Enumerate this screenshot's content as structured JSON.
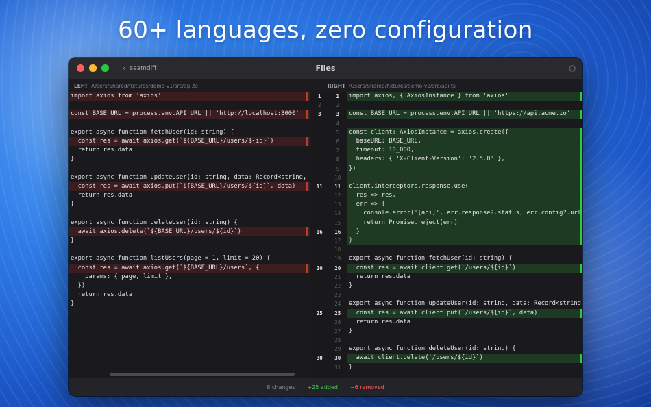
{
  "headline": "60+ languages, zero configuration",
  "window": {
    "app_name": "seamdiff",
    "title": "Files"
  },
  "paths": {
    "left_tag": "LEFT",
    "left_path": "/Users/Shared/fixtures/demo-v1/src/api.ts",
    "right_tag": "RIGHT",
    "right_path": "/Users/Shared/fixtures/demo-v2/src/api.ts"
  },
  "left_lines": [
    {
      "text": "import axios from 'axios'",
      "type": "del"
    },
    {
      "text": "",
      "type": "ctx"
    },
    {
      "text": "const BASE_URL = process.env.API_URL || 'http://localhost:3000'",
      "type": "del"
    },
    {
      "text": "",
      "type": "ctx"
    },
    {
      "text": "export async function fetchUser(id: string) {",
      "type": "ctx"
    },
    {
      "text": "  const res = await axios.get(`${BASE_URL}/users/${id}`)",
      "type": "del"
    },
    {
      "text": "  return res.data",
      "type": "ctx"
    },
    {
      "text": "}",
      "type": "ctx"
    },
    {
      "text": "",
      "type": "ctx"
    },
    {
      "text": "export async function updateUser(id: string, data: Record<string,",
      "type": "ctx"
    },
    {
      "text": "  const res = await axios.put(`${BASE_URL}/users/${id}`, data)",
      "type": "del"
    },
    {
      "text": "  return res.data",
      "type": "ctx"
    },
    {
      "text": "}",
      "type": "ctx"
    },
    {
      "text": "",
      "type": "ctx"
    },
    {
      "text": "export async function deleteUser(id: string) {",
      "type": "ctx"
    },
    {
      "text": "  await axios.delete(`${BASE_URL}/users/${id}`)",
      "type": "del"
    },
    {
      "text": "}",
      "type": "ctx"
    },
    {
      "text": "",
      "type": "ctx"
    },
    {
      "text": "export async function listUsers(page = 1, limit = 20) {",
      "type": "ctx"
    },
    {
      "text": "  const res = await axios.get(`${BASE_URL}/users`, {",
      "type": "del"
    },
    {
      "text": "    params: { page, limit },",
      "type": "ctx"
    },
    {
      "text": "  })",
      "type": "ctx"
    },
    {
      "text": "  return res.data",
      "type": "ctx"
    },
    {
      "text": "}",
      "type": "ctx"
    }
  ],
  "gutter": [
    {
      "l": "1",
      "r": "1",
      "hl": true
    },
    {
      "l": "2",
      "r": "2",
      "hl": false
    },
    {
      "l": "3",
      "r": "3",
      "hl": true
    },
    {
      "l": "",
      "r": "4",
      "hl": false
    },
    {
      "l": "",
      "r": "5",
      "hl": false
    },
    {
      "l": "",
      "r": "6",
      "hl": false
    },
    {
      "l": "",
      "r": "7",
      "hl": false
    },
    {
      "l": "",
      "r": "8",
      "hl": false
    },
    {
      "l": "",
      "r": "9",
      "hl": false
    },
    {
      "l": "",
      "r": "10",
      "hl": false
    },
    {
      "l": "11",
      "r": "11",
      "hl": true
    },
    {
      "l": "",
      "r": "12",
      "hl": false
    },
    {
      "l": "",
      "r": "13",
      "hl": false
    },
    {
      "l": "",
      "r": "14",
      "hl": false
    },
    {
      "l": "",
      "r": "15",
      "hl": false
    },
    {
      "l": "16",
      "r": "16",
      "hl": true
    },
    {
      "l": "",
      "r": "17",
      "hl": false
    },
    {
      "l": "",
      "r": "18",
      "hl": false
    },
    {
      "l": "",
      "r": "19",
      "hl": false
    },
    {
      "l": "20",
      "r": "20",
      "hl": true
    },
    {
      "l": "",
      "r": "21",
      "hl": false
    },
    {
      "l": "",
      "r": "22",
      "hl": false
    },
    {
      "l": "",
      "r": "23",
      "hl": false
    },
    {
      "l": "",
      "r": "24",
      "hl": false
    },
    {
      "l": "25",
      "r": "25",
      "hl": true
    },
    {
      "l": "",
      "r": "26",
      "hl": false
    },
    {
      "l": "",
      "r": "27",
      "hl": false
    },
    {
      "l": "",
      "r": "28",
      "hl": false
    },
    {
      "l": "",
      "r": "29",
      "hl": false
    },
    {
      "l": "30",
      "r": "30",
      "hl": true
    },
    {
      "l": "",
      "r": "31",
      "hl": false
    }
  ],
  "right_lines": [
    {
      "text": "import axios, { AxiosInstance } from 'axios'",
      "type": "add"
    },
    {
      "text": "",
      "type": "ctx"
    },
    {
      "text": "const BASE_URL = process.env.API_URL || 'https://api.acme.io'",
      "type": "add"
    },
    {
      "text": "",
      "type": "ctx"
    },
    {
      "text": "const client: AxiosInstance = axios.create({",
      "type": "add"
    },
    {
      "text": "  baseURL: BASE_URL,",
      "type": "add"
    },
    {
      "text": "  timeout: 10_000,",
      "type": "add"
    },
    {
      "text": "  headers: { 'X-Client-Version': '2.5.0' },",
      "type": "add"
    },
    {
      "text": "})",
      "type": "add"
    },
    {
      "text": "",
      "type": "add"
    },
    {
      "text": "client.interceptors.response.use(",
      "type": "add"
    },
    {
      "text": "  res => res,",
      "type": "add"
    },
    {
      "text": "  err => {",
      "type": "add"
    },
    {
      "text": "    console.error('[api]', err.response?.status, err.config?.url",
      "type": "add"
    },
    {
      "text": "    return Promise.reject(err)",
      "type": "add"
    },
    {
      "text": "  }",
      "type": "add"
    },
    {
      "text": ")",
      "type": "add"
    },
    {
      "text": "",
      "type": "ctx"
    },
    {
      "text": "export async function fetchUser(id: string) {",
      "type": "ctx"
    },
    {
      "text": "  const res = await client.get(`/users/${id}`)",
      "type": "add"
    },
    {
      "text": "  return res.data",
      "type": "ctx"
    },
    {
      "text": "}",
      "type": "ctx"
    },
    {
      "text": "",
      "type": "ctx"
    },
    {
      "text": "export async function updateUser(id: string, data: Record<string",
      "type": "ctx"
    },
    {
      "text": "  const res = await client.put(`/users/${id}`, data)",
      "type": "add"
    },
    {
      "text": "  return res.data",
      "type": "ctx"
    },
    {
      "text": "}",
      "type": "ctx"
    },
    {
      "text": "",
      "type": "ctx"
    },
    {
      "text": "export async function deleteUser(id: string) {",
      "type": "ctx"
    },
    {
      "text": "  await client.delete(`/users/${id}`)",
      "type": "add"
    },
    {
      "text": "}",
      "type": "ctx"
    }
  ],
  "status": {
    "changes": "8 changes",
    "added": "+25 added",
    "removed": "−6 removed"
  },
  "colors": {
    "added": "#2ecc40",
    "removed": "#c0392b",
    "background": "#1e1e22"
  }
}
